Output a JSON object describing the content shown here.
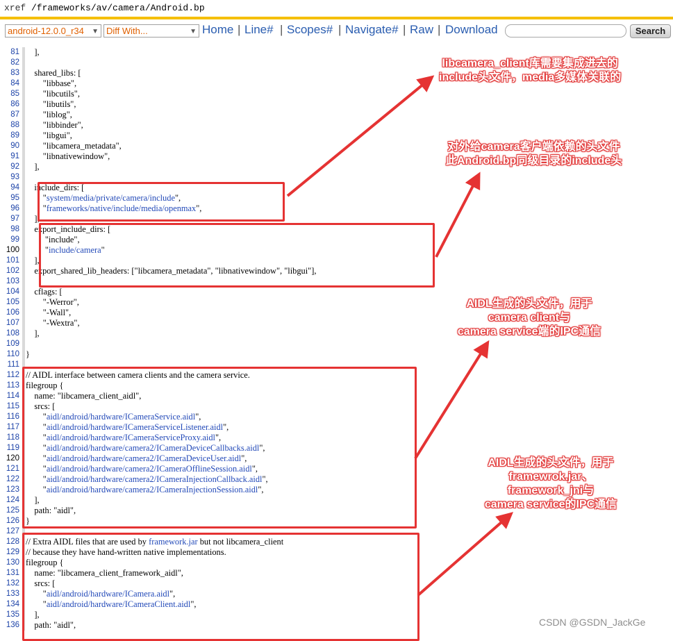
{
  "header": {
    "xref": "xref",
    "path": "/frameworks/av/camera/Android.bp"
  },
  "nav": {
    "branch": "android-12.0.0_r34",
    "diff": "Diff With...",
    "links": [
      "Home",
      "Line#",
      "Scopes#",
      "Navigate#",
      "Raw",
      "Download"
    ],
    "search_button": "Search"
  },
  "code": [
    {
      "n": "81",
      "t": "    ],"
    },
    {
      "n": "82",
      "t": ""
    },
    {
      "n": "83",
      "t": "    shared_libs: ["
    },
    {
      "n": "84",
      "t": "        \"libbase\","
    },
    {
      "n": "85",
      "t": "        \"libcutils\","
    },
    {
      "n": "86",
      "t": "        \"libutils\","
    },
    {
      "n": "87",
      "t": "        \"liblog\","
    },
    {
      "n": "88",
      "t": "        \"libbinder\","
    },
    {
      "n": "89",
      "t": "        \"libgui\","
    },
    {
      "n": "90",
      "t": "        \"libcamera_metadata\","
    },
    {
      "n": "91",
      "t": "        \"libnativewindow\","
    },
    {
      "n": "92",
      "t": "    ],"
    },
    {
      "n": "93",
      "t": ""
    },
    {
      "n": "94",
      "t": "    include_dirs: ["
    },
    {
      "n": "95",
      "t": "        \"system/media/private/camera/include\","
    },
    {
      "n": "96",
      "t": "        \"frameworks/native/include/media/openmax\","
    },
    {
      "n": "97",
      "t": "    ],"
    },
    {
      "n": "98",
      "t": "    export_include_dirs: ["
    },
    {
      "n": "99",
      "t": "         \"include\","
    },
    {
      "n": "100",
      "t": "         \"include/camera\""
    },
    {
      "n": "101",
      "t": "    ],"
    },
    {
      "n": "102",
      "t": "    export_shared_lib_headers: [\"libcamera_metadata\", \"libnativewindow\", \"libgui\"],"
    },
    {
      "n": "103",
      "t": ""
    },
    {
      "n": "104",
      "t": "    cflags: ["
    },
    {
      "n": "105",
      "t": "        \"-Werror\","
    },
    {
      "n": "106",
      "t": "        \"-Wall\","
    },
    {
      "n": "107",
      "t": "        \"-Wextra\","
    },
    {
      "n": "108",
      "t": "    ],"
    },
    {
      "n": "109",
      "t": ""
    },
    {
      "n": "110",
      "t": "}"
    },
    {
      "n": "111",
      "t": ""
    },
    {
      "n": "112",
      "t": "// AIDL interface between camera clients and the camera service."
    },
    {
      "n": "113",
      "t": "filegroup {"
    },
    {
      "n": "114",
      "t": "    name: \"libcamera_client_aidl\","
    },
    {
      "n": "115",
      "t": "    srcs: ["
    },
    {
      "n": "116",
      "t": "        \"aidl/android/hardware/ICameraService.aidl\","
    },
    {
      "n": "117",
      "t": "        \"aidl/android/hardware/ICameraServiceListener.aidl\","
    },
    {
      "n": "118",
      "t": "        \"aidl/android/hardware/ICameraServiceProxy.aidl\","
    },
    {
      "n": "119",
      "t": "        \"aidl/android/hardware/camera2/ICameraDeviceCallbacks.aidl\","
    },
    {
      "n": "120",
      "t": "        \"aidl/android/hardware/camera2/ICameraDeviceUser.aidl\","
    },
    {
      "n": "121",
      "t": "        \"aidl/android/hardware/camera2/ICameraOfflineSession.aidl\","
    },
    {
      "n": "122",
      "t": "        \"aidl/android/hardware/camera2/ICameraInjectionCallback.aidl\","
    },
    {
      "n": "123",
      "t": "        \"aidl/android/hardware/camera2/ICameraInjectionSession.aidl\","
    },
    {
      "n": "124",
      "t": "    ],"
    },
    {
      "n": "125",
      "t": "    path: \"aidl\","
    },
    {
      "n": "126",
      "t": "}"
    },
    {
      "n": "127",
      "t": ""
    },
    {
      "n": "128",
      "t": "// Extra AIDL files that are used by framework.jar but not libcamera_client"
    },
    {
      "n": "129",
      "t": "// because they have hand-written native implementations."
    },
    {
      "n": "130",
      "t": "filegroup {"
    },
    {
      "n": "131",
      "t": "    name: \"libcamera_client_framework_aidl\","
    },
    {
      "n": "132",
      "t": "    srcs: ["
    },
    {
      "n": "133",
      "t": "        \"aidl/android/hardware/ICamera.aidl\","
    },
    {
      "n": "134",
      "t": "        \"aidl/android/hardware/ICameraClient.aidl\","
    },
    {
      "n": "135",
      "t": "    ],"
    },
    {
      "n": "136",
      "t": "    path: \"aidl\","
    }
  ],
  "annotations": [
    {
      "lines": [
        "libcamera_client库需要集成进去的",
        "include头文件，media多媒体关联的"
      ]
    },
    {
      "lines": [
        "对外给camera客户端依赖的头文件",
        "此Android.bp同级目录的include头"
      ]
    },
    {
      "lines": [
        "AIDL生成的头文件，用于",
        "camera client与",
        "camera service端的IPC通信"
      ]
    },
    {
      "lines": [
        "AIDL生成的头文件，用于",
        "framewrok.jar、",
        "framework_jni与",
        "camera service的IPC通信"
      ]
    }
  ],
  "watermark": "CSDN @GSDN_JackGe",
  "colors": {
    "accent_red": "#e53333",
    "header_rule": "#f5bf00",
    "link_blue": "#2a5db0"
  }
}
